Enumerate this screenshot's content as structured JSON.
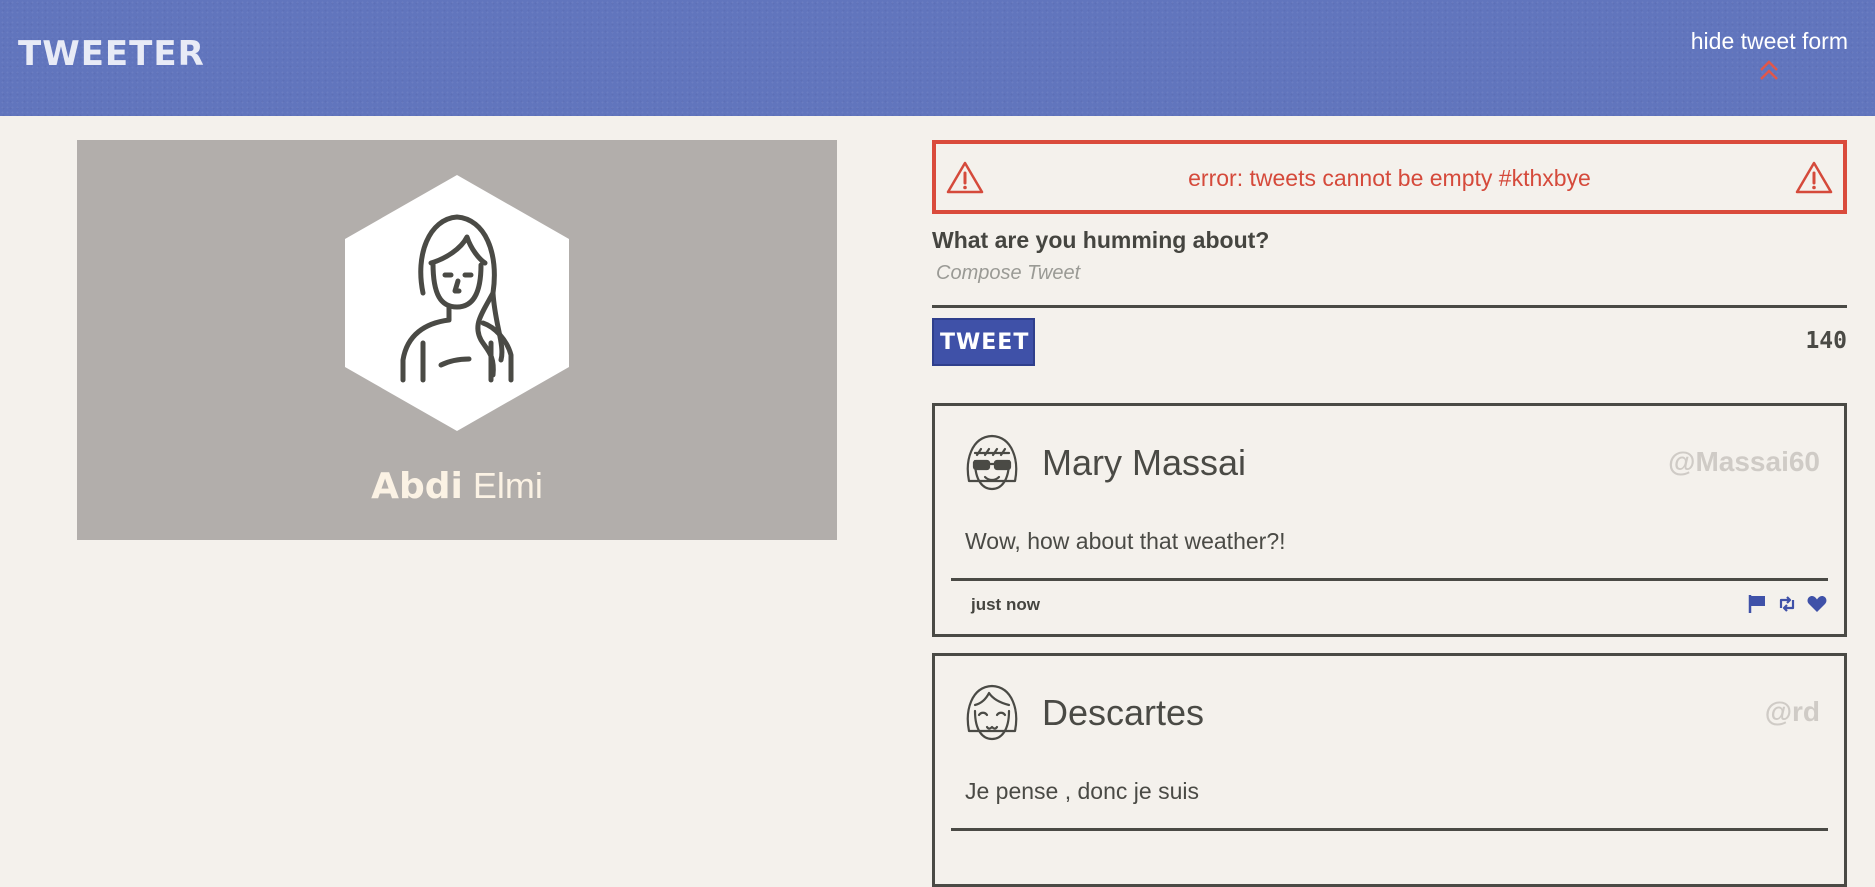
{
  "nav": {
    "brand": "TWEETER",
    "toggle_label": "hide tweet form",
    "toggle_icon": "double-chevron-up-icon",
    "accent": "#6175bd"
  },
  "profile": {
    "first_name": "Abdi",
    "last_name": "Elmi",
    "avatar_icon": "girl-avatar-icon"
  },
  "error": {
    "message": "error: tweets cannot be empty #kthxbye",
    "icon": "warning-icon",
    "color": "#da4b3c"
  },
  "compose": {
    "label": "What are you humming about?",
    "placeholder": "Compose Tweet",
    "value": "",
    "button_label": "TWEET",
    "counter": "140",
    "button_color": "#3f51a8"
  },
  "tweets": [
    {
      "name": "Mary Massai",
      "handle": "@Massai60",
      "text": "Wow, how about that weather?!",
      "time": "just now",
      "avatar_icon": "sunglasses-avatar-icon"
    },
    {
      "name": "Descartes",
      "handle": "@rd",
      "text": "Je pense , donc je suis",
      "time": "",
      "avatar_icon": "smiling-avatar-icon"
    }
  ],
  "actions": [
    "flag-icon",
    "retweet-icon",
    "heart-icon"
  ]
}
